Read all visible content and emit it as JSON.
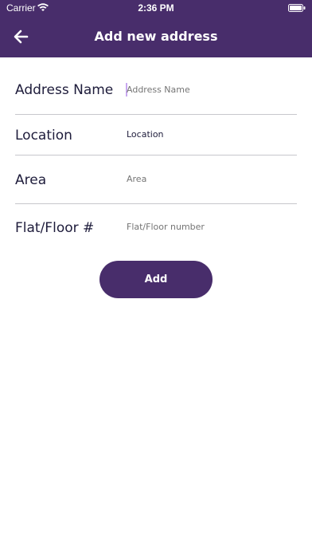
{
  "status_bar": {
    "carrier": "Carrier",
    "time": "2:36 PM"
  },
  "nav": {
    "title": "Add new address",
    "back_icon": "arrow-left-icon"
  },
  "form": {
    "fields": [
      {
        "label": "Address Name",
        "placeholder": "Address Name",
        "value": ""
      },
      {
        "label": "Location",
        "placeholder": "Location",
        "value": "Location"
      },
      {
        "label": "Area",
        "placeholder": "Area",
        "value": ""
      },
      {
        "label": "Flat/Floor #",
        "placeholder": "Flat/Floor number",
        "value": ""
      }
    ],
    "submit_label": "Add"
  },
  "colors": {
    "primary": "#482D6B",
    "text_dark": "#1E1C3B",
    "placeholder": "#8E8E93"
  }
}
